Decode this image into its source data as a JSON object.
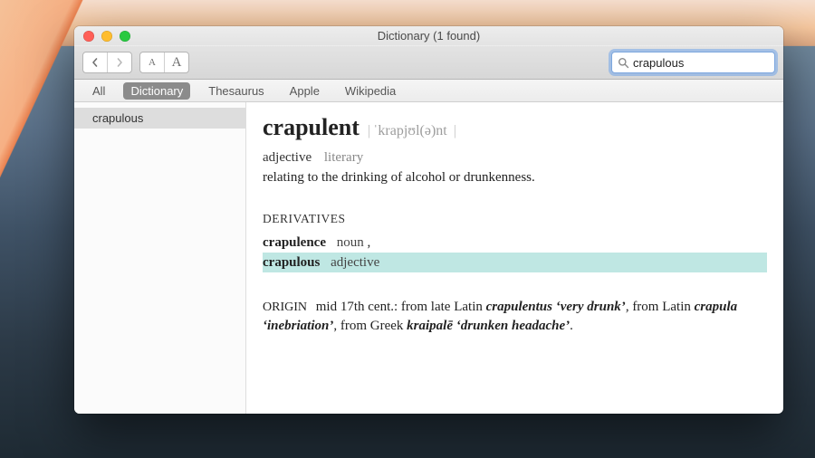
{
  "window": {
    "title": "Dictionary (1 found)"
  },
  "toolbar": {
    "font_small": "A",
    "font_big": "A"
  },
  "search": {
    "value": "crapulous"
  },
  "scope": {
    "items": [
      "All",
      "Dictionary",
      "Thesaurus",
      "Apple",
      "Wikipedia"
    ],
    "selected_index": 1
  },
  "sidebar": {
    "items": [
      "crapulous"
    ],
    "selected_index": 0
  },
  "entry": {
    "headword": "crapulent",
    "pronunciation": "ˈkrapjʊl(ə)nt",
    "pos": "adjective",
    "register": "literary",
    "definition": "relating to the drinking of alcohol or drunkenness.",
    "derivatives_label": "DERIVATIVES",
    "derivatives": [
      {
        "word": "crapulence",
        "pos": "noun",
        "trailing": ","
      },
      {
        "word": "crapulous",
        "pos": "adjective",
        "trailing": ""
      }
    ],
    "highlighted_derivative_index": 1,
    "origin_label": "ORIGIN",
    "origin_plain1": "mid 17th cent.: from late Latin ",
    "origin_bi1": "crapulentus ‘very drunk’",
    "origin_plain2": ", from Latin ",
    "origin_bi2": "crapula ‘inebriation’",
    "origin_plain3": ", from Greek ",
    "origin_bi3": "kraipalē ‘drunken headache’",
    "origin_plain4": "."
  }
}
